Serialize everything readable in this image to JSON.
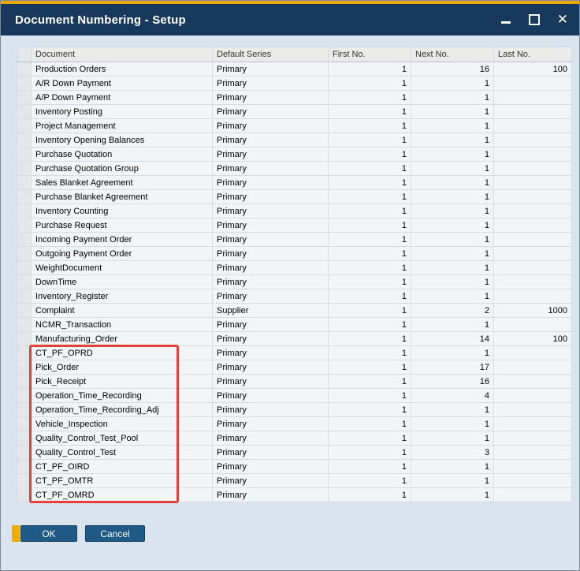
{
  "window": {
    "title": "Document Numbering - Setup"
  },
  "table": {
    "columns": [
      "Document",
      "Default Series",
      "First No.",
      "Next No.",
      "Last No."
    ],
    "rows": [
      {
        "document": "Production Orders",
        "series": "Primary",
        "first": "1",
        "next": "16",
        "last": "100"
      },
      {
        "document": "A/R Down Payment",
        "series": "Primary",
        "first": "1",
        "next": "1",
        "last": ""
      },
      {
        "document": "A/P Down Payment",
        "series": "Primary",
        "first": "1",
        "next": "1",
        "last": ""
      },
      {
        "document": "Inventory Posting",
        "series": "Primary",
        "first": "1",
        "next": "1",
        "last": ""
      },
      {
        "document": "Project Management",
        "series": "Primary",
        "first": "1",
        "next": "1",
        "last": ""
      },
      {
        "document": "Inventory Opening Balances",
        "series": "Primary",
        "first": "1",
        "next": "1",
        "last": ""
      },
      {
        "document": "Purchase Quotation",
        "series": "Primary",
        "first": "1",
        "next": "1",
        "last": ""
      },
      {
        "document": "Purchase Quotation Group",
        "series": "Primary",
        "first": "1",
        "next": "1",
        "last": ""
      },
      {
        "document": "Sales Blanket Agreement",
        "series": "Primary",
        "first": "1",
        "next": "1",
        "last": ""
      },
      {
        "document": "Purchase Blanket Agreement",
        "series": "Primary",
        "first": "1",
        "next": "1",
        "last": ""
      },
      {
        "document": "Inventory Counting",
        "series": "Primary",
        "first": "1",
        "next": "1",
        "last": ""
      },
      {
        "document": "Purchase Request",
        "series": "Primary",
        "first": "1",
        "next": "1",
        "last": ""
      },
      {
        "document": "Incoming Payment Order",
        "series": "Primary",
        "first": "1",
        "next": "1",
        "last": ""
      },
      {
        "document": "Outgoing Payment Order",
        "series": "Primary",
        "first": "1",
        "next": "1",
        "last": ""
      },
      {
        "document": "WeightDocument",
        "series": "Primary",
        "first": "1",
        "next": "1",
        "last": ""
      },
      {
        "document": "DownTime",
        "series": "Primary",
        "first": "1",
        "next": "1",
        "last": ""
      },
      {
        "document": "Inventory_Register",
        "series": "Primary",
        "first": "1",
        "next": "1",
        "last": ""
      },
      {
        "document": "Complaint",
        "series": "Supplier",
        "first": "1",
        "next": "2",
        "last": "1000"
      },
      {
        "document": "NCMR_Transaction",
        "series": "Primary",
        "first": "1",
        "next": "1",
        "last": ""
      },
      {
        "document": "Manufacturing_Order",
        "series": "Primary",
        "first": "1",
        "next": "14",
        "last": "100"
      },
      {
        "document": "CT_PF_OPRD",
        "series": "Primary",
        "first": "1",
        "next": "1",
        "last": ""
      },
      {
        "document": "Pick_Order",
        "series": "Primary",
        "first": "1",
        "next": "17",
        "last": ""
      },
      {
        "document": "Pick_Receipt",
        "series": "Primary",
        "first": "1",
        "next": "16",
        "last": ""
      },
      {
        "document": "Operation_Time_Recording",
        "series": "Primary",
        "first": "1",
        "next": "4",
        "last": ""
      },
      {
        "document": "Operation_Time_Recording_Adj",
        "series": "Primary",
        "first": "1",
        "next": "1",
        "last": ""
      },
      {
        "document": "Vehicle_Inspection",
        "series": "Primary",
        "first": "1",
        "next": "1",
        "last": ""
      },
      {
        "document": "Quality_Control_Test_Pool",
        "series": "Primary",
        "first": "1",
        "next": "1",
        "last": ""
      },
      {
        "document": "Quality_Control_Test",
        "series": "Primary",
        "first": "1",
        "next": "3",
        "last": ""
      },
      {
        "document": "CT_PF_OIRD",
        "series": "Primary",
        "first": "1",
        "next": "1",
        "last": ""
      },
      {
        "document": "CT_PF_OMTR",
        "series": "Primary",
        "first": "1",
        "next": "1",
        "last": ""
      },
      {
        "document": "CT_PF_OMRD",
        "series": "Primary",
        "first": "1",
        "next": "1",
        "last": ""
      }
    ]
  },
  "footer": {
    "ok_label": "OK",
    "cancel_label": "Cancel"
  },
  "annotation": {
    "color": "#e0413a"
  },
  "theme": {
    "accent": "#f0ab00",
    "titlebar": "#17395e",
    "button": "#205a86"
  }
}
